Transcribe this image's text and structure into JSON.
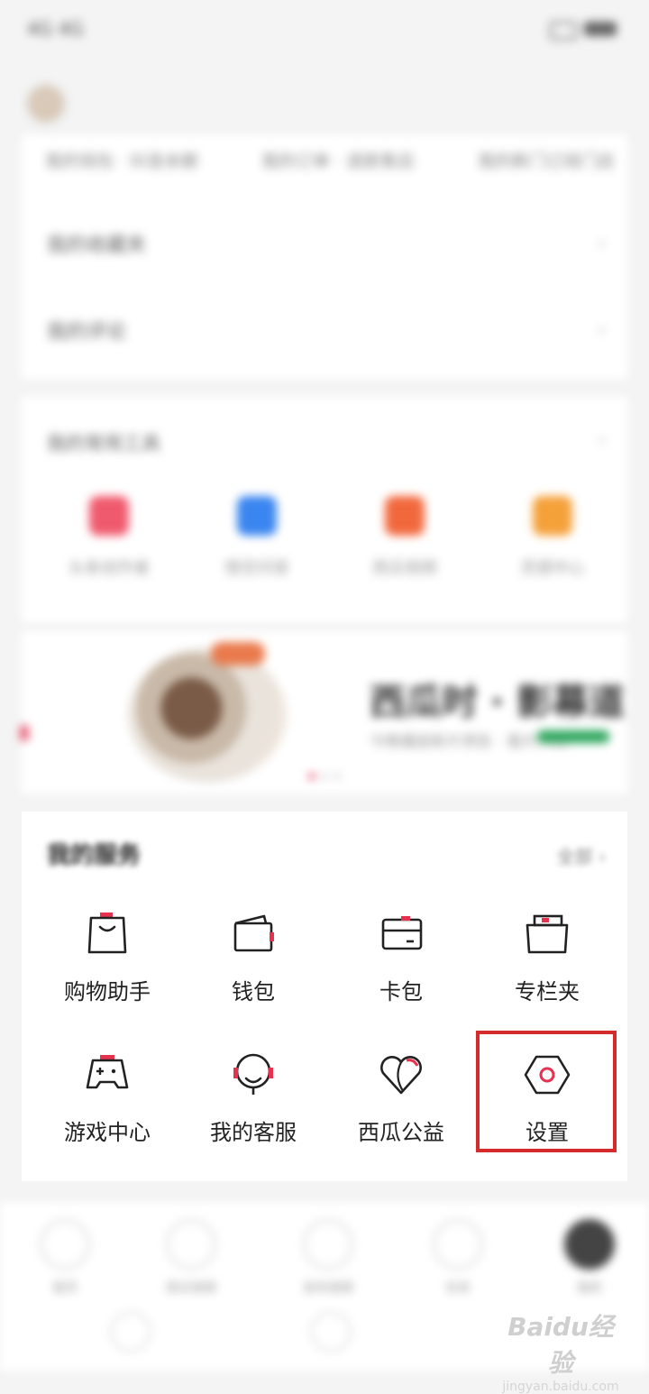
{
  "status_bar": {
    "left_text": "4G 4G"
  },
  "top_tabs": [
    "我的钱包 · 抖音余额",
    "我的订单 · 退款售后",
    "我的新门订阅门店"
  ],
  "list_rows": [
    "我的收藏夹",
    "我的评论"
  ],
  "tools_section": {
    "heading": "我的常用工具",
    "items": [
      {
        "label": "头条创作者",
        "color": "#f05a6e"
      },
      {
        "label": "悟空问答",
        "color": "#3a86f0"
      },
      {
        "label": "西瓜视频",
        "color": "#f2683d"
      },
      {
        "label": "灵感中心",
        "color": "#f4a13a"
      }
    ]
  },
  "banner": {
    "title": "西瓜时 · 影幕道",
    "subtitle": "今晚播放新片预告 · 看片入口"
  },
  "services": {
    "title": "我的服务",
    "all_label": "全部 ›",
    "items": [
      {
        "label": "购物助手",
        "icon": "shopping-bag-icon"
      },
      {
        "label": "钱包",
        "icon": "wallet-icon"
      },
      {
        "label": "卡包",
        "icon": "card-icon"
      },
      {
        "label": "专栏夹",
        "icon": "folder-icon"
      },
      {
        "label": "游戏中心",
        "icon": "gamepad-icon"
      },
      {
        "label": "我的客服",
        "icon": "headset-icon"
      },
      {
        "label": "西瓜公益",
        "icon": "heart-icon"
      },
      {
        "label": "设置",
        "icon": "settings-hexagon-icon"
      }
    ]
  },
  "bottom_nav": [
    "首页",
    "西瓜视频",
    "发布视频",
    "任务",
    "我的"
  ],
  "watermark": {
    "line1": "Baidu经验",
    "line2": "jingyan.baidu.com"
  },
  "colors": {
    "accent": "#e4324f",
    "highlight_box": "#d62b2b"
  }
}
